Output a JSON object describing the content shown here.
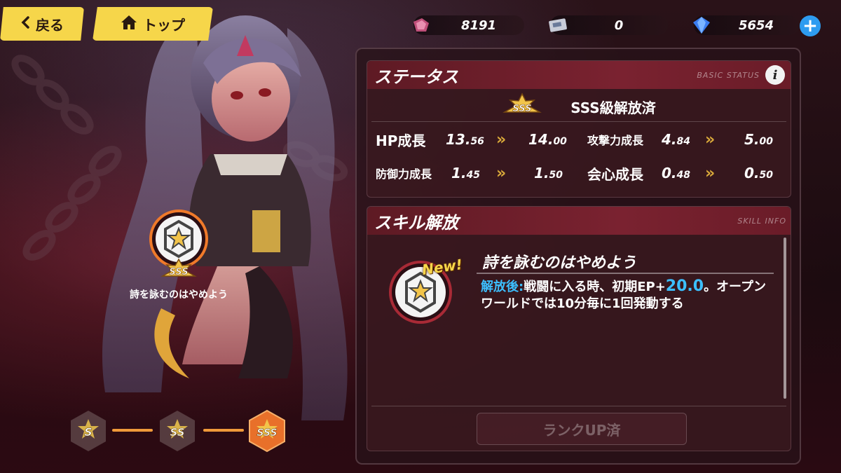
{
  "nav": {
    "back_label": "戻る",
    "top_label": "トップ"
  },
  "currency": {
    "fragments": "8191",
    "tickets": "0",
    "crystals": "5654"
  },
  "status": {
    "title": "ステータス",
    "subtitle": "BASIC STATUS",
    "rank_badge": "SSS",
    "rank_label": "SSS級解放済",
    "stats": [
      {
        "name": "HP成長",
        "from_int": "13.",
        "from_dec": "56",
        "to_int": "14.",
        "to_dec": "00"
      },
      {
        "name": "攻撃力成長",
        "from_int": "4.",
        "from_dec": "84",
        "to_int": "5.",
        "to_dec": "00"
      },
      {
        "name": "防御力成長",
        "from_int": "1.",
        "from_dec": "45",
        "to_int": "1.",
        "to_dec": "50"
      },
      {
        "name": "会心成長",
        "from_int": "0.",
        "from_dec": "48",
        "to_int": "0.",
        "to_dec": "50"
      }
    ]
  },
  "skill": {
    "title": "スキル解放",
    "subtitle": "SKILL INFO",
    "new_label": "New!",
    "name": "詩を詠むのはやめよう",
    "desc_keyword": "解放後:",
    "desc_part1": "戦闘に入る時、初期EP+",
    "desc_number": "20.0",
    "desc_part2": "。オープンワールドでは10分毎に1回発動する",
    "rankup_label": "ランクUP済"
  },
  "left_panel": {
    "rank_badge": "SSS",
    "skill_label": "詩を詠むのはやめよう"
  },
  "ranks": [
    "S",
    "SS",
    "SSS"
  ],
  "colors": {
    "accent_yellow": "#f6d64a",
    "highlight_blue": "#3cbfff",
    "header_red": "#7a2230",
    "rank_orange": "#f09a3a"
  }
}
